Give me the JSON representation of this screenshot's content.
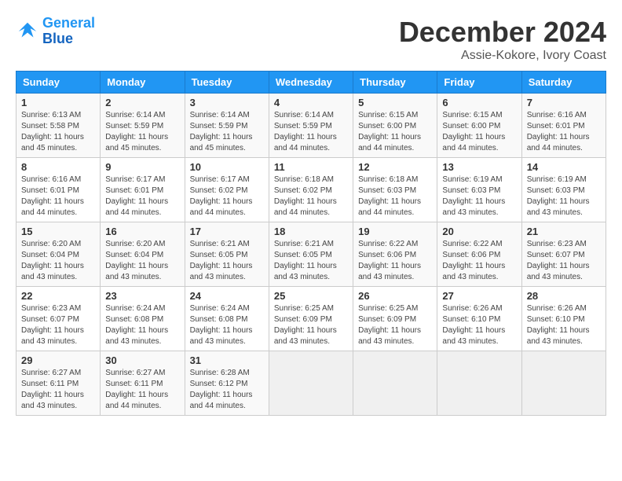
{
  "header": {
    "logo_line1": "General",
    "logo_line2": "Blue",
    "month": "December 2024",
    "location": "Assie-Kokore, Ivory Coast"
  },
  "weekdays": [
    "Sunday",
    "Monday",
    "Tuesday",
    "Wednesday",
    "Thursday",
    "Friday",
    "Saturday"
  ],
  "weeks": [
    [
      {
        "day": "1",
        "info": "Sunrise: 6:13 AM\nSunset: 5:58 PM\nDaylight: 11 hours and 45 minutes."
      },
      {
        "day": "2",
        "info": "Sunrise: 6:14 AM\nSunset: 5:59 PM\nDaylight: 11 hours and 45 minutes."
      },
      {
        "day": "3",
        "info": "Sunrise: 6:14 AM\nSunset: 5:59 PM\nDaylight: 11 hours and 45 minutes."
      },
      {
        "day": "4",
        "info": "Sunrise: 6:14 AM\nSunset: 5:59 PM\nDaylight: 11 hours and 44 minutes."
      },
      {
        "day": "5",
        "info": "Sunrise: 6:15 AM\nSunset: 6:00 PM\nDaylight: 11 hours and 44 minutes."
      },
      {
        "day": "6",
        "info": "Sunrise: 6:15 AM\nSunset: 6:00 PM\nDaylight: 11 hours and 44 minutes."
      },
      {
        "day": "7",
        "info": "Sunrise: 6:16 AM\nSunset: 6:01 PM\nDaylight: 11 hours and 44 minutes."
      }
    ],
    [
      {
        "day": "8",
        "info": "Sunrise: 6:16 AM\nSunset: 6:01 PM\nDaylight: 11 hours and 44 minutes."
      },
      {
        "day": "9",
        "info": "Sunrise: 6:17 AM\nSunset: 6:01 PM\nDaylight: 11 hours and 44 minutes."
      },
      {
        "day": "10",
        "info": "Sunrise: 6:17 AM\nSunset: 6:02 PM\nDaylight: 11 hours and 44 minutes."
      },
      {
        "day": "11",
        "info": "Sunrise: 6:18 AM\nSunset: 6:02 PM\nDaylight: 11 hours and 44 minutes."
      },
      {
        "day": "12",
        "info": "Sunrise: 6:18 AM\nSunset: 6:03 PM\nDaylight: 11 hours and 44 minutes."
      },
      {
        "day": "13",
        "info": "Sunrise: 6:19 AM\nSunset: 6:03 PM\nDaylight: 11 hours and 43 minutes."
      },
      {
        "day": "14",
        "info": "Sunrise: 6:19 AM\nSunset: 6:03 PM\nDaylight: 11 hours and 43 minutes."
      }
    ],
    [
      {
        "day": "15",
        "info": "Sunrise: 6:20 AM\nSunset: 6:04 PM\nDaylight: 11 hours and 43 minutes."
      },
      {
        "day": "16",
        "info": "Sunrise: 6:20 AM\nSunset: 6:04 PM\nDaylight: 11 hours and 43 minutes."
      },
      {
        "day": "17",
        "info": "Sunrise: 6:21 AM\nSunset: 6:05 PM\nDaylight: 11 hours and 43 minutes."
      },
      {
        "day": "18",
        "info": "Sunrise: 6:21 AM\nSunset: 6:05 PM\nDaylight: 11 hours and 43 minutes."
      },
      {
        "day": "19",
        "info": "Sunrise: 6:22 AM\nSunset: 6:06 PM\nDaylight: 11 hours and 43 minutes."
      },
      {
        "day": "20",
        "info": "Sunrise: 6:22 AM\nSunset: 6:06 PM\nDaylight: 11 hours and 43 minutes."
      },
      {
        "day": "21",
        "info": "Sunrise: 6:23 AM\nSunset: 6:07 PM\nDaylight: 11 hours and 43 minutes."
      }
    ],
    [
      {
        "day": "22",
        "info": "Sunrise: 6:23 AM\nSunset: 6:07 PM\nDaylight: 11 hours and 43 minutes."
      },
      {
        "day": "23",
        "info": "Sunrise: 6:24 AM\nSunset: 6:08 PM\nDaylight: 11 hours and 43 minutes."
      },
      {
        "day": "24",
        "info": "Sunrise: 6:24 AM\nSunset: 6:08 PM\nDaylight: 11 hours and 43 minutes."
      },
      {
        "day": "25",
        "info": "Sunrise: 6:25 AM\nSunset: 6:09 PM\nDaylight: 11 hours and 43 minutes."
      },
      {
        "day": "26",
        "info": "Sunrise: 6:25 AM\nSunset: 6:09 PM\nDaylight: 11 hours and 43 minutes."
      },
      {
        "day": "27",
        "info": "Sunrise: 6:26 AM\nSunset: 6:10 PM\nDaylight: 11 hours and 43 minutes."
      },
      {
        "day": "28",
        "info": "Sunrise: 6:26 AM\nSunset: 6:10 PM\nDaylight: 11 hours and 43 minutes."
      }
    ],
    [
      {
        "day": "29",
        "info": "Sunrise: 6:27 AM\nSunset: 6:11 PM\nDaylight: 11 hours and 43 minutes."
      },
      {
        "day": "30",
        "info": "Sunrise: 6:27 AM\nSunset: 6:11 PM\nDaylight: 11 hours and 44 minutes."
      },
      {
        "day": "31",
        "info": "Sunrise: 6:28 AM\nSunset: 6:12 PM\nDaylight: 11 hours and 44 minutes."
      },
      {
        "day": "",
        "info": ""
      },
      {
        "day": "",
        "info": ""
      },
      {
        "day": "",
        "info": ""
      },
      {
        "day": "",
        "info": ""
      }
    ]
  ]
}
